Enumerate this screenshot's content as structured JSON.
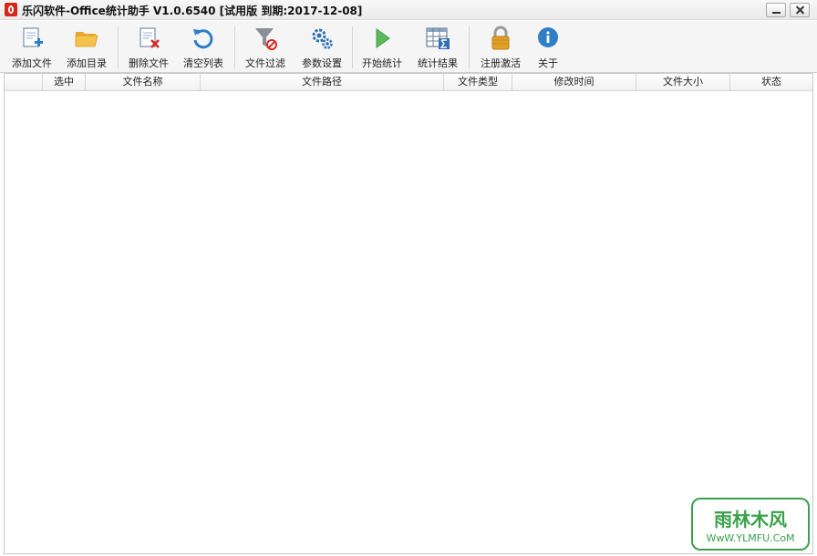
{
  "window": {
    "title": "乐闪软件-Office统计助手 V1.0.6540 [试用版 到期:2017-12-08]"
  },
  "toolbar": {
    "add_file": "添加文件",
    "add_dir": "添加目录",
    "delete_file": "删除文件",
    "clear_list": "清空列表",
    "file_filter": "文件过滤",
    "param_settings": "参数设置",
    "start_stats": "开始统计",
    "stats_result": "统计结果",
    "register": "注册激活",
    "about": "关于"
  },
  "table": {
    "columns": [
      "",
      "选中",
      "文件名称",
      "文件路径",
      "文件类型",
      "修改时间",
      "文件大小",
      "状态"
    ]
  },
  "watermark": {
    "title": "雨林木风",
    "url": "WwW.YLMFU.CoM"
  },
  "colors": {
    "accent_red": "#d9261c",
    "icon_blue": "#2f7fc8",
    "play_green": "#5cb85c",
    "lock_gold": "#e0a12b",
    "watermark_green": "#3aa14a"
  }
}
